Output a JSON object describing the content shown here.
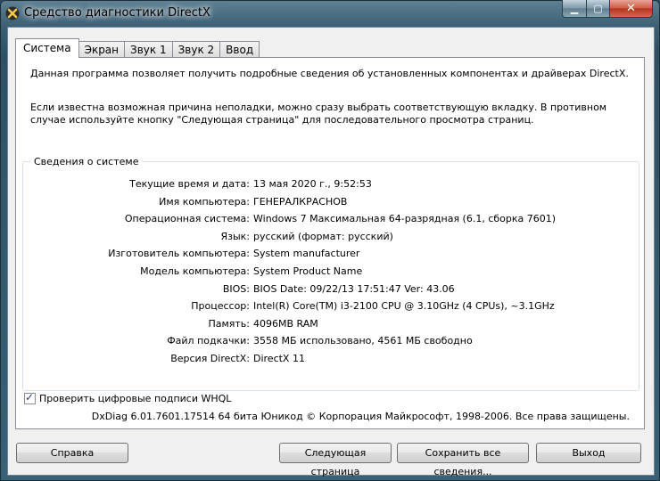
{
  "window": {
    "title": "Средство диагностики DirectX"
  },
  "controls": {
    "minimize": "▁",
    "maximize": "▢",
    "close": "✕"
  },
  "tabs": [
    {
      "label": "Система",
      "active": true
    },
    {
      "label": "Экран"
    },
    {
      "label": "Звук 1"
    },
    {
      "label": "Звук 2"
    },
    {
      "label": "Ввод"
    }
  ],
  "intro": {
    "line1": "Данная программа позволяет получить подробные сведения об установленных компонентах и драйверах DirectX.",
    "line2": "Если известна возможная причина неполадки, можно сразу выбрать соответствующую вкладку. В противном случае используйте кнопку \"Следующая страница\" для последовательного просмотра страниц."
  },
  "system_info": {
    "title": "Сведения о системе",
    "rows": [
      {
        "label": "Текущие время и дата:",
        "value": "13 мая 2020 г., 9:52:53"
      },
      {
        "label": "Имя компьютера:",
        "value": "ГЕНЕРАЛКРАСНОВ"
      },
      {
        "label": "Операционная система:",
        "value": "Windows 7 Максимальная 64-разрядная (6.1, сборка 7601)"
      },
      {
        "label": "Язык:",
        "value": "русский (формат: русский)"
      },
      {
        "label": "Изготовитель компьютера:",
        "value": "System manufacturer"
      },
      {
        "label": "Модель компьютера:",
        "value": "System Product Name"
      },
      {
        "label": "BIOS:",
        "value": "BIOS Date: 09/22/13 17:51:47 Ver: 43.06"
      },
      {
        "label": "Процессор:",
        "value": "Intel(R) Core(TM) i3-2100 CPU @ 3.10GHz (4 CPUs), ~3.1GHz"
      },
      {
        "label": "Память:",
        "value": "4096MB RAM"
      },
      {
        "label": "Файл подкачки:",
        "value": "3558 МБ использовано, 4561 МБ свободно"
      },
      {
        "label": "Версия DirectX:",
        "value": "DirectX 11"
      }
    ]
  },
  "whql": {
    "label": "Проверить цифровые подписи WHQL",
    "checked": true
  },
  "footer": "DxDiag 6.01.7601.17514 64 бита Юникод  © Корпорация Майкрософт, 1998-2006.  Все права защищены.",
  "buttons": {
    "help": "Справка",
    "next": "Следующая страница",
    "save": "Сохранить все сведения...",
    "exit": "Выход"
  }
}
